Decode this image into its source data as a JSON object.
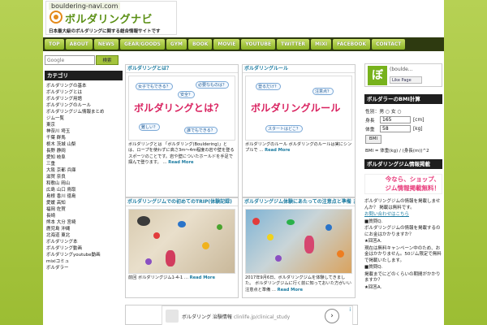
{
  "header": {
    "domain": "bouldering-navi.com",
    "title": "ボルダリングナビ",
    "subtitle": "日本最大級のボルダリングに関する総合情報サイトです"
  },
  "nav": [
    "TOP",
    "ABOUT",
    "NEWS",
    "GEAR/GOODS",
    "GYM",
    "BOOK",
    "MOVIE",
    "YOUTUBE",
    "TWITTER",
    "MIXI",
    "FACEBOOK",
    "CONTACT"
  ],
  "search": {
    "placeholder": "Google",
    "button_label": "検索"
  },
  "sidebar_left": {
    "title": "カテゴリ",
    "items": [
      "ボルダリングの基本",
      "ボルダリングとは",
      "ボルダリング用語",
      "ボルダリングのルール",
      "ボルダリングジム情報まとめ",
      "ジム一覧",
      "東京",
      "神奈川 埼玉",
      "千葉 群馬",
      "栃木 茨城 山梨",
      "長野 静岡",
      "愛知 岐阜",
      "三重",
      "大阪 京都 兵庫",
      "滋賀 奈良",
      "和歌山 岡山",
      "広島 山口 鳥取",
      "島根 香川 徳島",
      "愛媛 高知",
      "福岡 佐賀",
      "長崎",
      "熊本 大分 宮崎",
      "鹿児島 沖縄",
      "北海道 東北",
      "ボルダリング本",
      "ボルダリング動画",
      "ボルダリングyoutube動画",
      "mixiコミュ",
      "ボルダラー"
    ]
  },
  "posts": [
    {
      "title": "ボルダリングとは？",
      "image_heading": "ボルダリングとは？",
      "bubbles": [
        "女子でもできる？",
        "必要なものは？",
        "安全？",
        "難しい？",
        "誰でもできる？"
      ],
      "excerpt": "ボルダリングとは 「ボルダリング(Bouldering)」とは、ロープを使わずに高さ3m〜4m程度の岩や壁を登るスポーツのことです。岩や壁についたホールドを手足で掴んで登ります。",
      "read_more": "Read More"
    },
    {
      "title": "ボルダリングルール",
      "image_heading": "ボルダリングルール",
      "bubbles": [
        "登るだけ？",
        "注意点？",
        "スタートはどこ？"
      ],
      "excerpt": "ボルダリングのルール ボルダリングのルールは実にシンプルで",
      "read_more": "Read More"
    },
    {
      "title": "ボルダリングジムでの初めてのTRIP(体験記録)",
      "excerpt": "前回 ボルダリングジム1-4-1",
      "read_more": "Read More"
    },
    {
      "title": "ボルダリングジム体験にあたっての注意点と準備 まとめ",
      "excerpt": "2017年9月6日、ボルダリングジムを体験してきました。 ボルダリングジムに行く前に知っておいた方がいい注意点と準備",
      "read_more": "Read More"
    }
  ],
  "ad": {
    "text": "ボルダリング 治験情報",
    "url": "clinlife.jp/clinical_study",
    "arrow": "›",
    "info": "i"
  },
  "sidebar_right": {
    "fb_logo": "ぼ",
    "fb_name": "(boulde...",
    "fb_like": "Like Page",
    "bmi": {
      "title": "ボルダラーのBMI計算",
      "gender_label": "性別：男 ○ 女 ○",
      "height_label": "身長",
      "height_value": "165",
      "height_unit": "[cm]",
      "weight_label": "体重",
      "weight_value": "58",
      "weight_unit": "[kg]",
      "button": "BMI",
      "formula": "BMI = 体重(kg) / (身長(m))^2"
    },
    "promo_title": "ボルダリングジム情報掲載",
    "promo_text": [
      "今なら、ショップ、",
      "ジム情報掲載無料！"
    ],
    "faq": [
      "ボルダリングジムの情報を掲載しませんか？ 掲載は無料です。",
      "お問い合わせはこちら",
      "■質問Q.",
      "ボルダリングジムの情報を掲載するのにお金はかかりますか？",
      "★回答A.",
      "現在は無料キャンペーン中のため、お金はかかりません。50ジム限定で無料で掲載いたします。",
      "■質問Q.",
      "掲載までにどのくらいの期間がかかりますか？",
      "★回答A."
    ]
  }
}
